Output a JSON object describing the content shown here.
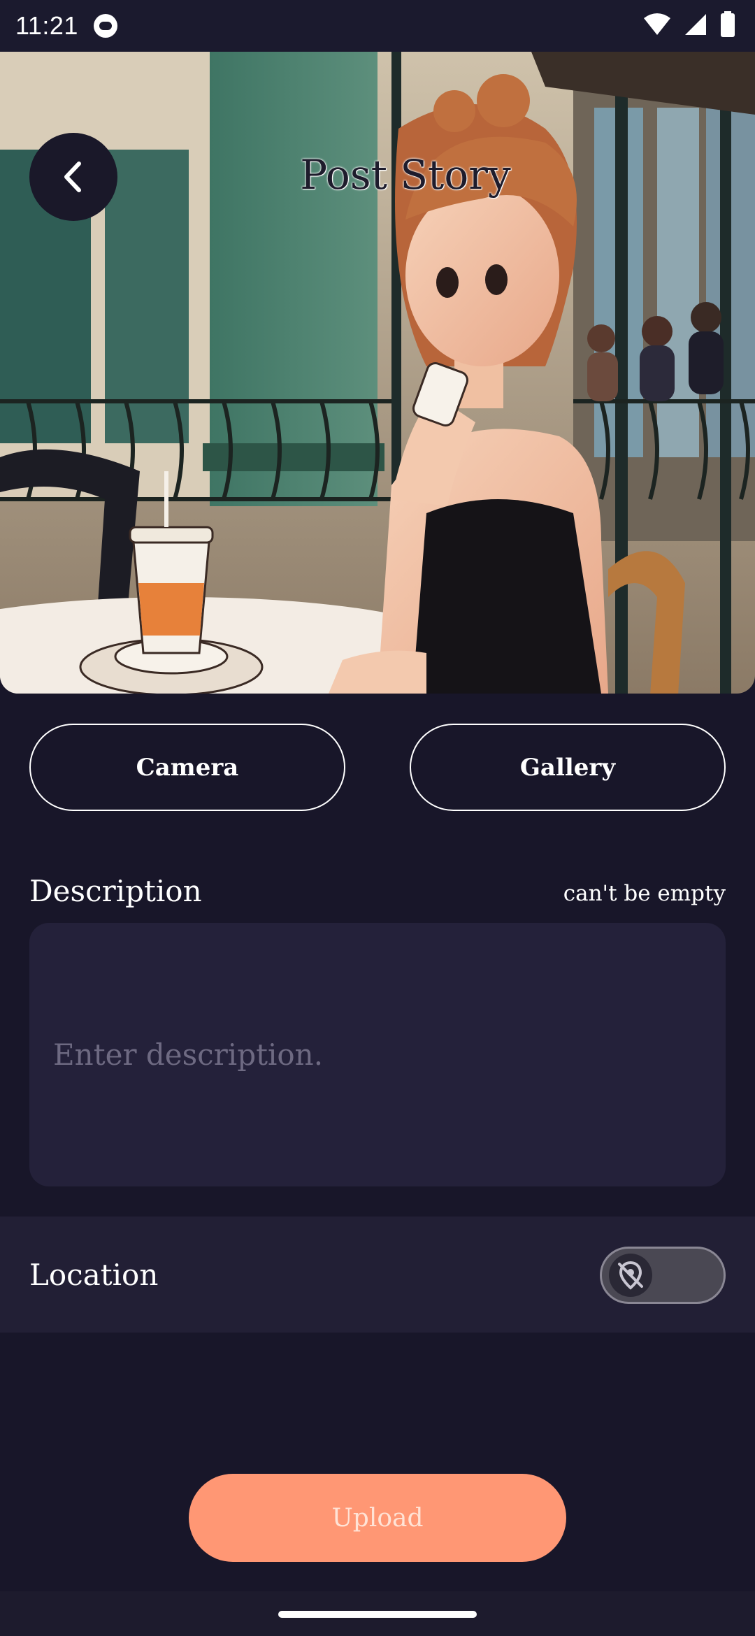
{
  "status_bar": {
    "time": "11:21",
    "icons": [
      "app-notification-icon",
      "wifi-icon",
      "cellular-signal-icon",
      "battery-icon"
    ]
  },
  "header": {
    "title": "Post Story",
    "back_icon": "chevron-left-icon"
  },
  "image_source": {
    "camera_label": "Camera",
    "gallery_label": "Gallery"
  },
  "description": {
    "label": "Description",
    "error": "can't be empty",
    "placeholder": "Enter description.",
    "value": ""
  },
  "location": {
    "label": "Location",
    "enabled": false,
    "toggle_icon": "location-off-icon"
  },
  "actions": {
    "upload_label": "Upload"
  },
  "colors": {
    "background": "#181629",
    "field": "#24213a",
    "accent": "#ff9774",
    "location_row": "#221f35"
  }
}
